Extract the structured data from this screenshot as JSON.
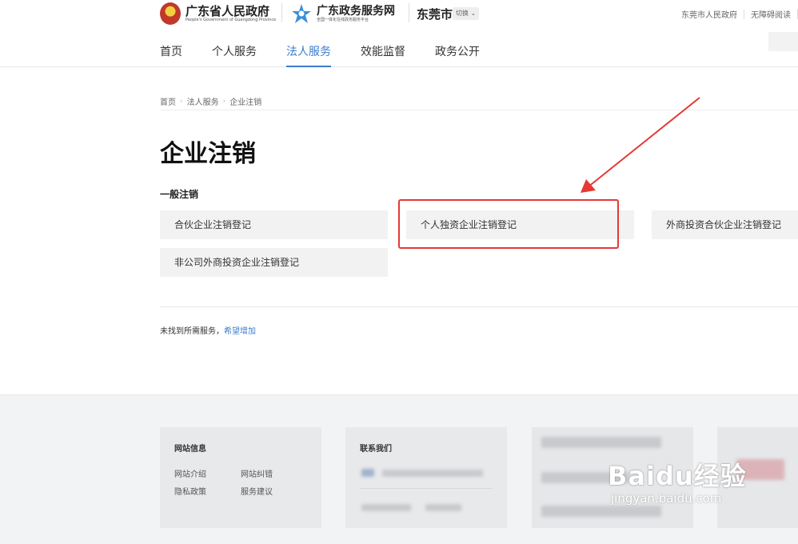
{
  "header": {
    "gov_title": "广东省人民政府",
    "gov_subtitle": "People's Government of Guangdong Province",
    "portal_title": "广东政务服务网",
    "portal_subtitle": "全国一体化在线政务服务平台",
    "city": "东莞市",
    "switch_label": "切换",
    "top_links": [
      "东莞市人民政府",
      "无障碍阅读"
    ],
    "nav": [
      {
        "label": "首页",
        "active": false
      },
      {
        "label": "个人服务",
        "active": false
      },
      {
        "label": "法人服务",
        "active": true
      },
      {
        "label": "效能监督",
        "active": false
      },
      {
        "label": "政务公开",
        "active": false
      }
    ]
  },
  "breadcrumb": [
    "首页",
    "法人服务",
    "企业注销"
  ],
  "page_title": "企业注销",
  "section_title": "一般注销",
  "services": [
    "合伙企业注销登记",
    "个人独资企业注销登记",
    "外商投资合伙企业注销登记",
    "非公司外商投资企业注销登记"
  ],
  "not_found": {
    "text": "未找到所需服务，",
    "link": "希望增加"
  },
  "footer": {
    "site_info_title": "网站信息",
    "site_info_links": [
      "网站介绍",
      "网站纠错",
      "隐私政策",
      "服务建议"
    ],
    "contact_title": "联系我们"
  },
  "watermark": {
    "main": "Baidu经验",
    "sub": "jingyan.baidu.com"
  },
  "colors": {
    "accent": "#3d7ccd",
    "highlight": "#e53935",
    "card_bg": "#f2f2f2"
  }
}
